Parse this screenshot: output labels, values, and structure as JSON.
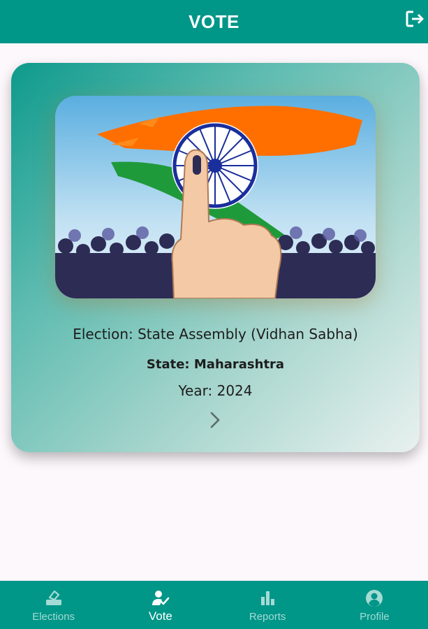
{
  "appbar": {
    "title": "VOTE",
    "logout_icon": "logout-icon"
  },
  "card": {
    "banner_icon": "indian-flag-vote-banner",
    "election": "Election: State Assembly (Vidhan Sabha)",
    "state": "State: Maharashtra",
    "year": "Year: 2024",
    "open_icon": "chevron-right-icon"
  },
  "nav": {
    "items": [
      {
        "label": "Elections",
        "icon": "ballot-box-icon",
        "active": false
      },
      {
        "label": "Vote",
        "icon": "person-check-icon",
        "active": true
      },
      {
        "label": "Reports",
        "icon": "bar-chart-icon",
        "active": false
      },
      {
        "label": "Profile",
        "icon": "account-circle-icon",
        "active": false
      }
    ]
  },
  "colors": {
    "primary": "#009688",
    "nav_inactive": "#a5dbd5",
    "background": "#fdf8fc",
    "saffron": "#ff6f00",
    "green": "#1f9a3a",
    "chakra_blue": "#1a2e9c"
  }
}
